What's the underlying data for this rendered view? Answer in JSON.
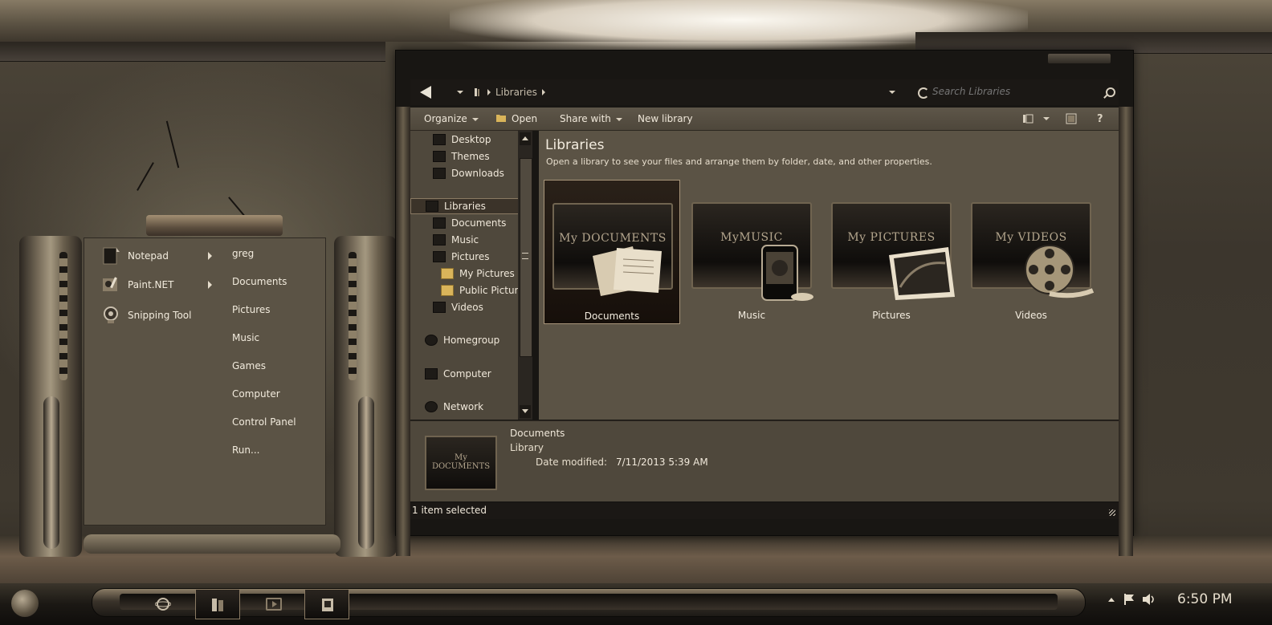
{
  "startmenu": {
    "programs": [
      {
        "label": "Notepad",
        "has_submenu": true
      },
      {
        "label": "Paint.NET",
        "has_submenu": true
      },
      {
        "label": "Snipping Tool",
        "has_submenu": false
      }
    ],
    "links": [
      "greg",
      "Documents",
      "Pictures",
      "Music",
      "Games",
      "Computer",
      "Control Panel",
      "Run..."
    ]
  },
  "explorer": {
    "address": {
      "crumb": "Libraries"
    },
    "search": {
      "placeholder": "Search Libraries"
    },
    "toolbar": {
      "organize": "Organize",
      "open": "Open",
      "share_with": "Share with",
      "new_library": "New library"
    },
    "nav": {
      "desktop": "Desktop",
      "themes": "Themes",
      "downloads": "Downloads",
      "libraries": "Libraries",
      "documents": "Documents",
      "music": "Music",
      "pictures": "Pictures",
      "my_pictures": "My Pictures",
      "public_pictures": "Public Pictures",
      "videos": "Videos",
      "homegroup": "Homegroup",
      "computer": "Computer",
      "network": "Network"
    },
    "content": {
      "title": "Libraries",
      "description": "Open a library to see your files and arrange them by folder, date, and other properties.",
      "tiles": [
        {
          "name": "Documents",
          "caption": "My DOCUMENTS",
          "icon": "documents-folder-icon"
        },
        {
          "name": "Music",
          "caption": "MyMUSIC",
          "icon": "music-folder-icon"
        },
        {
          "name": "Pictures",
          "caption": "My PICTURES",
          "icon": "pictures-folder-icon"
        },
        {
          "name": "Videos",
          "caption": "My VIDEOS",
          "icon": "videos-folder-icon"
        }
      ]
    },
    "details": {
      "name": "Documents",
      "type": "Library",
      "modified_label": "Date modified:",
      "modified_value": "7/11/2013 5:39 AM",
      "thumb_caption": "My DOCUMENTS"
    },
    "status": "1 item selected"
  },
  "taskbar": {
    "clock": "6:50 PM"
  },
  "colors": {
    "accent": "#8a7a63",
    "window_bg": "#5b5345",
    "nav_bg": "#4f483c",
    "text": "#f0e8da"
  }
}
